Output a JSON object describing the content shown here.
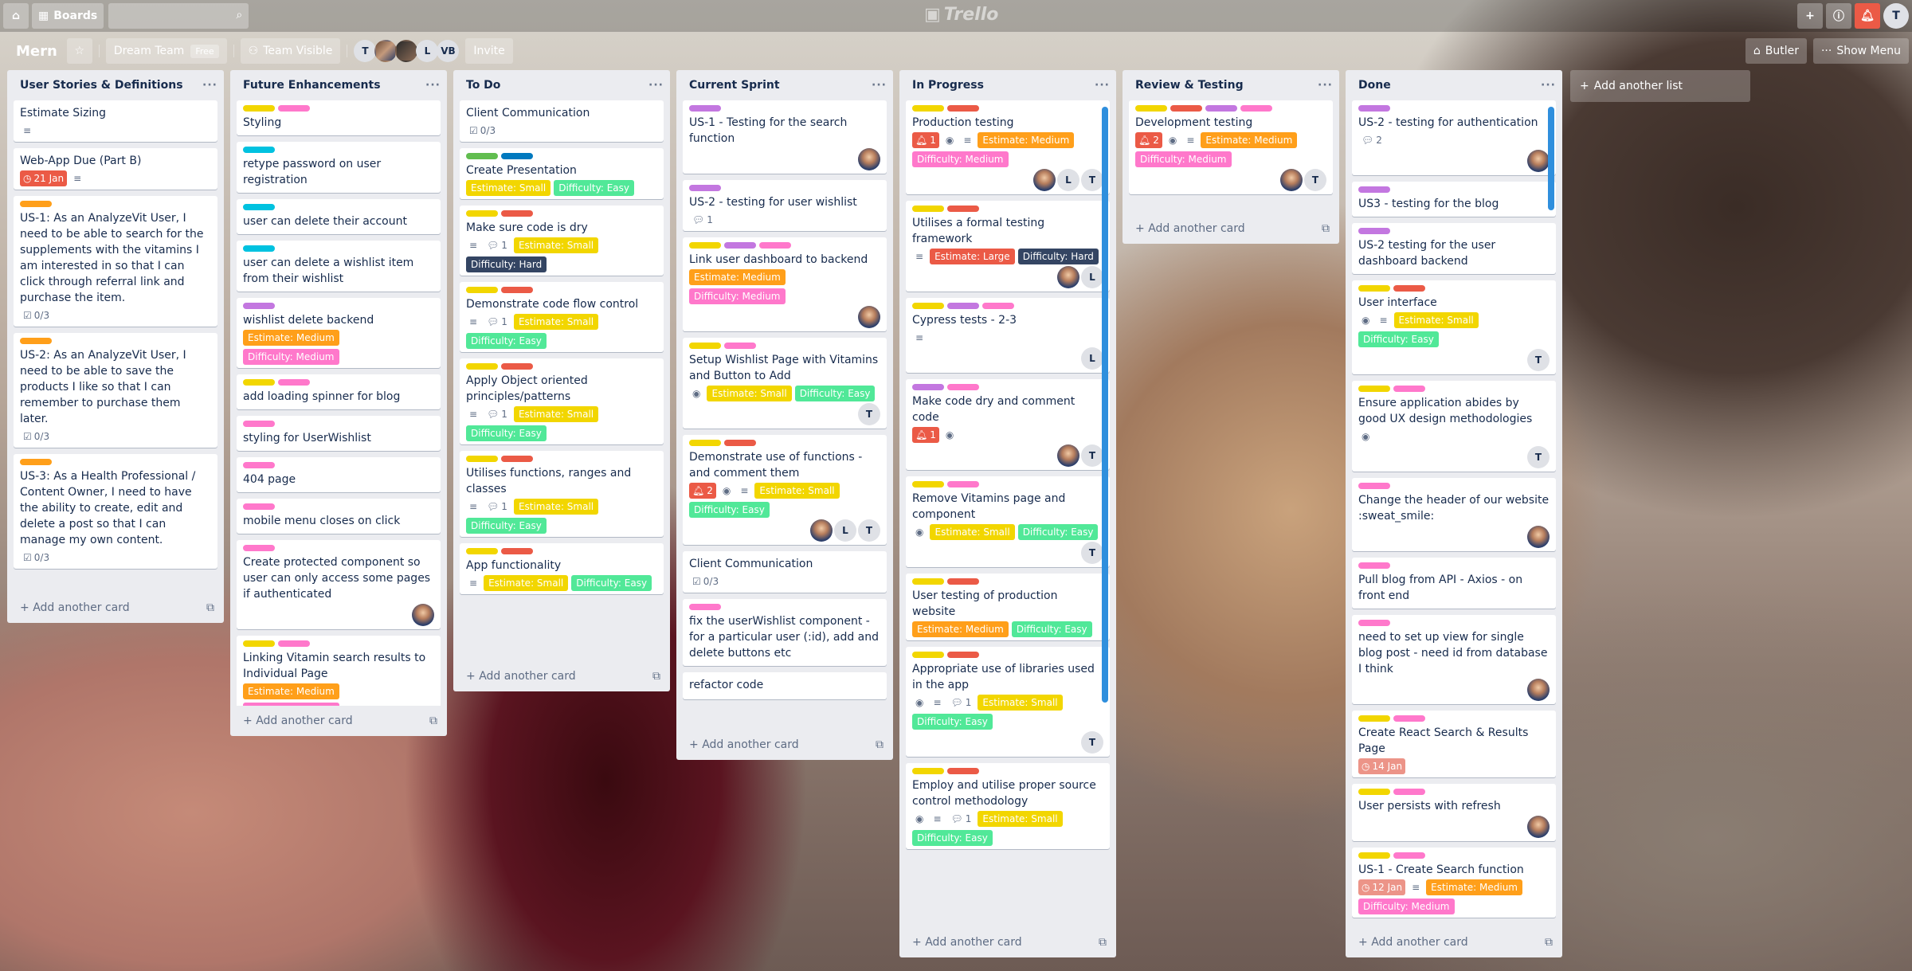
{
  "topbar": {
    "home_icon": "home-icon",
    "boards_label": "Boards",
    "search_placeholder": "",
    "logo": "Trello",
    "avatar_initial": "T"
  },
  "header": {
    "board_name": "Mern",
    "team": "Dream Team",
    "team_plan": "Free",
    "visibility": "Team Visible",
    "members": [
      "T",
      "",
      "",
      "L",
      "VB"
    ],
    "invite": "Invite",
    "butler": "Butler",
    "show_menu": "Show Menu"
  },
  "colors": {
    "yellow": "#f2d600",
    "orange": "#ff9f1a",
    "red": "#eb5a46",
    "purple": "#c377e0",
    "pink": "#ff78cb",
    "sky": "#00c2e0",
    "green": "#61bd4f",
    "blue": "#0079bf",
    "black": "#344563",
    "lime": "#51e898"
  },
  "add_card_label": "Add another card",
  "add_list_label": "Add another list",
  "lists": [
    {
      "name": "User Stories & Definitions",
      "cards": [
        {
          "title": "Estimate Sizing",
          "desc": true
        },
        {
          "title": "Web-App Due (Part B)",
          "due": "21 Jan",
          "due_style": "dueRed",
          "desc": true
        },
        {
          "labels": [
            "orange"
          ],
          "title": "US-1: As an AnalyzeVit User, I need to be able to search for the supplements with the vitamins I am interested in so that I can click through referral link and purchase the item.",
          "check": "0/3"
        },
        {
          "labels": [
            "orange"
          ],
          "title": "US-2: As an AnalyzeVit User, I need to be able to save the products I like so that I can remember to purchase them later.",
          "check": "0/3"
        },
        {
          "labels": [
            "orange"
          ],
          "title": "US-3: As a Health Professional / Content Owner, I need to have the ability to create, edit and delete a post so that I can manage my own content.",
          "check": "0/3"
        }
      ]
    },
    {
      "name": "Future Enhancements",
      "cards": [
        {
          "labels": [
            "yellow",
            "pink"
          ],
          "title": "Styling"
        },
        {
          "labels": [
            "sky"
          ],
          "title": "retype password on user registration"
        },
        {
          "labels": [
            "sky"
          ],
          "title": "user can delete their account"
        },
        {
          "labels": [
            "sky"
          ],
          "title": "user can delete a wishlist item from their wishlist"
        },
        {
          "labels": [
            "purple"
          ],
          "title": "wishlist delete backend",
          "tags": [
            [
              "Estimate: Medium",
              "orange"
            ],
            [
              "Difficulty: Medium",
              "pink"
            ]
          ]
        },
        {
          "labels": [
            "yellow",
            "pink"
          ],
          "title": "add loading spinner for blog"
        },
        {
          "labels": [
            "pink"
          ],
          "title": "styling for UserWishlist"
        },
        {
          "labels": [
            "pink"
          ],
          "title": "404 page"
        },
        {
          "labels": [
            "pink"
          ],
          "title": "mobile menu closes on click"
        },
        {
          "labels": [
            "pink"
          ],
          "title": "Create protected component so user can only access some pages if authenticated",
          "members": [
            "ph"
          ]
        },
        {
          "labels": [
            "yellow",
            "pink"
          ],
          "title": "Linking Vitamin search results to Individual Page",
          "tags": [
            [
              "Estimate: Medium",
              "orange"
            ],
            [
              "Difficulty: Medium",
              "pink"
            ]
          ]
        }
      ]
    },
    {
      "name": "To Do",
      "cards": [
        {
          "title": "Client Communication",
          "check": "0/3"
        },
        {
          "labels": [
            "green",
            "blue"
          ],
          "title": "Create Presentation",
          "tags": [
            [
              "Estimate: Small",
              "yellow"
            ],
            [
              "Difficulty: Easy",
              "lime"
            ]
          ]
        },
        {
          "labels": [
            "yellow",
            "red"
          ],
          "title": "Make sure code is dry",
          "desc": true,
          "comments": "1",
          "tags": [
            [
              "Estimate: Small",
              "yellow"
            ],
            [
              "Difficulty: Hard",
              "black"
            ]
          ]
        },
        {
          "labels": [
            "yellow",
            "red"
          ],
          "title": "Demonstrate code flow control",
          "desc": true,
          "comments": "1",
          "tags": [
            [
              "Estimate: Small",
              "yellow"
            ],
            [
              "Difficulty: Easy",
              "lime"
            ]
          ]
        },
        {
          "labels": [
            "yellow",
            "red"
          ],
          "title": "Apply Object oriented principles/patterns",
          "desc": true,
          "comments": "1",
          "tags": [
            [
              "Estimate: Small",
              "yellow"
            ],
            [
              "Difficulty: Easy",
              "lime"
            ]
          ]
        },
        {
          "labels": [
            "yellow",
            "red"
          ],
          "title": "Utilises functions, ranges and classes",
          "desc": true,
          "comments": "1",
          "tags": [
            [
              "Estimate: Small",
              "yellow"
            ],
            [
              "Difficulty: Easy",
              "lime"
            ]
          ]
        },
        {
          "labels": [
            "yellow",
            "red"
          ],
          "title": "App functionality",
          "desc": true,
          "tags": [
            [
              "Estimate: Small",
              "yellow"
            ],
            [
              "Difficulty: Easy",
              "lime"
            ]
          ]
        }
      ]
    },
    {
      "name": "Current Sprint",
      "cards": [
        {
          "labels": [
            "purple"
          ],
          "title": "US-1 - Testing for the search function",
          "members": [
            "ph"
          ]
        },
        {
          "labels": [
            "purple"
          ],
          "title": "US-2 - testing for user wishlist",
          "comments": "1"
        },
        {
          "labels": [
            "yellow",
            "purple",
            "pink"
          ],
          "title": "Link user dashboard to backend",
          "tags": [
            [
              "Estimate: Medium",
              "orange"
            ],
            [
              "Difficulty: Medium",
              "pink"
            ]
          ],
          "members": [
            "ph"
          ]
        },
        {
          "labels": [
            "yellow",
            "pink"
          ],
          "title": "Setup Wishlist Page with Vitamins and Button to Add",
          "watch": true,
          "tags": [
            [
              "Estimate: Small",
              "yellow"
            ],
            [
              "Difficulty: Easy",
              "lime"
            ]
          ],
          "members": [
            "T"
          ]
        },
        {
          "labels": [
            "yellow",
            "red"
          ],
          "title": "Demonstrate use of functions - and comment them",
          "bell": "2",
          "watch": true,
          "desc": true,
          "tags": [
            [
              "Estimate: Small",
              "yellow"
            ],
            [
              "Difficulty: Easy",
              "lime"
            ]
          ],
          "members": [
            "ph",
            "L",
            "T"
          ]
        },
        {
          "title": "Client Communication",
          "check": "0/3"
        },
        {
          "labels": [
            "pink"
          ],
          "title": "fix the userWishlist component - for a particular user (:id), add and delete buttons etc"
        },
        {
          "title": "refactor code"
        }
      ]
    },
    {
      "name": "In Progress",
      "cards": [
        {
          "labels": [
            "yellow",
            "red"
          ],
          "title": "Production testing",
          "bell": "1",
          "watch": true,
          "desc": true,
          "tags": [
            [
              "Estimate: Medium",
              "orange"
            ],
            [
              "Difficulty: Medium",
              "pink"
            ]
          ],
          "members": [
            "ph",
            "L",
            "T"
          ]
        },
        {
          "labels": [
            "yellow",
            "red"
          ],
          "title": "Utilises a formal testing framework",
          "desc": true,
          "tags": [
            [
              "Estimate: Large",
              "red"
            ],
            [
              "Difficulty: Hard",
              "black"
            ]
          ],
          "members": [
            "ph",
            "L"
          ]
        },
        {
          "labels": [
            "yellow",
            "purple",
            "pink"
          ],
          "title": "Cypress tests - 2-3",
          "desc": true,
          "members": [
            "L"
          ]
        },
        {
          "labels": [
            "purple",
            "pink"
          ],
          "title": "Make code dry and comment code",
          "bell": "1",
          "watch": true,
          "members": [
            "ph",
            "T"
          ]
        },
        {
          "labels": [
            "yellow",
            "pink"
          ],
          "title": "Remove Vitamins page and component",
          "watch": true,
          "tags": [
            [
              "Estimate: Small",
              "yellow"
            ],
            [
              "Difficulty: Easy",
              "lime"
            ]
          ],
          "members": [
            "T"
          ]
        },
        {
          "labels": [
            "yellow",
            "red"
          ],
          "title": "User testing of production website",
          "tags": [
            [
              "Estimate: Medium",
              "orange"
            ],
            [
              "Difficulty: Easy",
              "lime"
            ]
          ]
        },
        {
          "labels": [
            "yellow",
            "red"
          ],
          "title": "Appropriate use of libraries used in the app",
          "watch": true,
          "desc": true,
          "comments": "1",
          "tags": [
            [
              "Estimate: Small",
              "yellow"
            ],
            [
              "Difficulty: Easy",
              "lime"
            ]
          ],
          "members": [
            "T"
          ]
        },
        {
          "labels": [
            "yellow",
            "red"
          ],
          "title": "Employ and utilise proper source control methodology",
          "watch": true,
          "desc": true,
          "comments": "1",
          "tags": [
            [
              "Estimate: Small",
              "yellow"
            ],
            [
              "Difficulty: Easy",
              "lime"
            ]
          ]
        }
      ]
    },
    {
      "name": "Review & Testing",
      "cards": [
        {
          "labels": [
            "yellow",
            "red",
            "purple",
            "pink"
          ],
          "title": "Development testing",
          "bell": "2",
          "watch": true,
          "desc": true,
          "tags": [
            [
              "Estimate: Medium",
              "orange"
            ],
            [
              "Difficulty: Medium",
              "pink"
            ]
          ],
          "members": [
            "ph",
            "T"
          ]
        }
      ]
    },
    {
      "name": "Done",
      "cards": [
        {
          "labels": [
            "purple"
          ],
          "title": "US-2 - testing for authentication",
          "comments": "2",
          "members": [
            "ph"
          ]
        },
        {
          "labels": [
            "purple"
          ],
          "title": "US3 - testing for the blog"
        },
        {
          "labels": [
            "purple"
          ],
          "title": "US-2 testing for the user dashboard backend"
        },
        {
          "labels": [
            "yellow",
            "red"
          ],
          "title": "User interface",
          "watch": true,
          "desc": true,
          "tags": [
            [
              "Estimate: Small",
              "yellow"
            ],
            [
              "Difficulty: Easy",
              "lime"
            ]
          ],
          "members": [
            "T"
          ]
        },
        {
          "labels": [
            "yellow",
            "pink"
          ],
          "title": "Ensure application abides by good UX design methodologies",
          "watch": true,
          "members": [
            "T"
          ]
        },
        {
          "labels": [
            "pink"
          ],
          "title": "Change the header of our website :sweat_smile:",
          "members": [
            "ph"
          ]
        },
        {
          "labels": [
            "pink"
          ],
          "title": "Pull blog from API - Axios - on front end"
        },
        {
          "labels": [
            "pink"
          ],
          "title": "need to set up view for single blog post - need id from database I think",
          "members": [
            "ph"
          ]
        },
        {
          "labels": [
            "yellow",
            "pink"
          ],
          "title": "Create React Search & Results Page",
          "due": "14 Jan",
          "due_style": "due"
        },
        {
          "labels": [
            "yellow",
            "pink"
          ],
          "title": "User persists with refresh",
          "members": [
            "ph"
          ]
        },
        {
          "labels": [
            "yellow",
            "pink"
          ],
          "title": "US-1 - Create Search function",
          "due": "12 Jan",
          "due_style": "due",
          "desc": true,
          "tags": [
            [
              "Estimate: Medium",
              "orange"
            ],
            [
              "Difficulty: Medium",
              "pink"
            ]
          ]
        }
      ]
    }
  ]
}
